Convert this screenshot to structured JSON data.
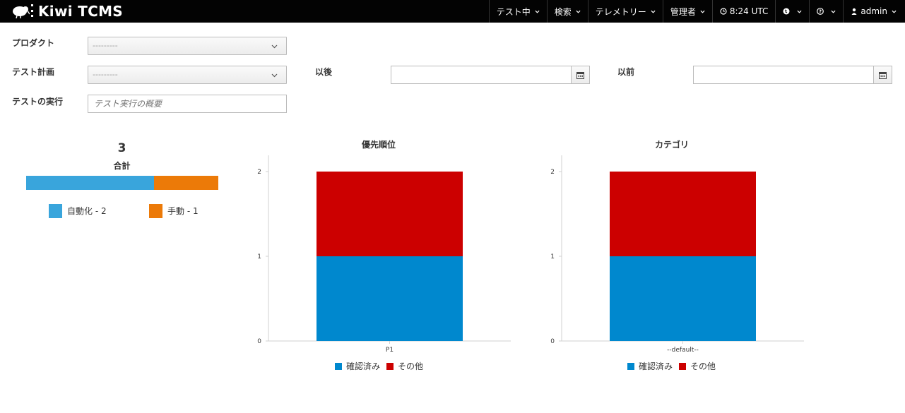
{
  "navbar": {
    "brand": "Kiwi TCMS",
    "items": [
      {
        "label": "テスト中"
      },
      {
        "label": "検索"
      },
      {
        "label": "テレメトリー"
      },
      {
        "label": "管理者"
      },
      {
        "label": "8:24 UTC"
      },
      {
        "label": ""
      },
      {
        "label": ""
      },
      {
        "label": "admin"
      }
    ]
  },
  "form": {
    "product_label": "プロダクト",
    "product_value": "---------",
    "plan_label": "テスト計画",
    "plan_value": "---------",
    "after_label": "以後",
    "after_value": "",
    "before_label": "以前",
    "before_value": "",
    "run_label": "テストの実行",
    "run_placeholder": "テスト実行の概要"
  },
  "summary": {
    "total": "3",
    "total_label": "合計",
    "automated_label": "自動化 - 2",
    "manual_label": "手動 - 1",
    "automated": 2,
    "manual": 1,
    "colors": {
      "automated": "#39a5dc",
      "manual": "#ec7a08"
    }
  },
  "chart_data": [
    {
      "type": "bar",
      "title": "優先順位",
      "categories": [
        "P1"
      ],
      "series": [
        {
          "name": "確認済み",
          "values": [
            1
          ],
          "color": "#0088ce"
        },
        {
          "name": "その他",
          "values": [
            1
          ],
          "color": "#cc0000"
        }
      ],
      "stacked": true,
      "ylim": [
        0,
        2
      ],
      "yticks": [
        "0",
        "1",
        "2"
      ],
      "legend": "bottom"
    },
    {
      "type": "bar",
      "title": "カテゴリ",
      "categories": [
        "--default--"
      ],
      "series": [
        {
          "name": "確認済み",
          "values": [
            1
          ],
          "color": "#0088ce"
        },
        {
          "name": "その他",
          "values": [
            1
          ],
          "color": "#cc0000"
        }
      ],
      "stacked": true,
      "ylim": [
        0,
        2
      ],
      "yticks": [
        "0",
        "1",
        "2"
      ],
      "legend": "bottom"
    }
  ]
}
